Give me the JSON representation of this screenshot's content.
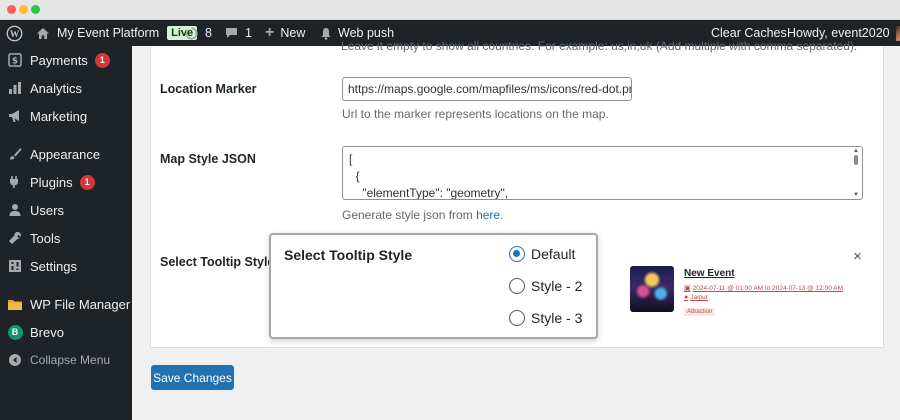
{
  "admin_bar": {
    "site_name": "My Event Platform",
    "live_badge": "Live",
    "updates_count": "8",
    "comments_count": "1",
    "new_label": "New",
    "web_push_label": "Web push",
    "clear_caches_label": "Clear Caches",
    "howdy_label": "Howdy, event2020"
  },
  "sidebar": {
    "items": [
      {
        "label": "Payments",
        "icon": "dollar-icon",
        "badge": "1"
      },
      {
        "label": "Analytics",
        "icon": "bar-chart-icon"
      },
      {
        "label": "Marketing",
        "icon": "megaphone-icon"
      },
      {
        "label": "Appearance",
        "icon": "paintbrush-icon"
      },
      {
        "label": "Plugins",
        "icon": "plugin-icon",
        "badge": "1"
      },
      {
        "label": "Users",
        "icon": "user-icon"
      },
      {
        "label": "Tools",
        "icon": "wrench-icon"
      },
      {
        "label": "Settings",
        "icon": "settings-icon"
      },
      {
        "label": "WP File Manager",
        "icon": "folder-icon"
      },
      {
        "label": "Brevo",
        "icon": "brevo-icon"
      },
      {
        "label": "Collapse Menu",
        "icon": "collapse-icon"
      }
    ]
  },
  "form": {
    "cut_off_description": "Leave it empty to show all countries. For example: us,in,uk (Add multiple with comma separated).",
    "location_marker": {
      "label": "Location Marker",
      "value": "https://maps.google.com/mapfiles/ms/icons/red-dot.png",
      "description": "Url to the marker represents locations on the map."
    },
    "map_style_json": {
      "label": "Map Style JSON",
      "lines": [
        "[",
        "  {",
        "    \"elementType\": \"geometry\","
      ],
      "description_prefix": "Generate style json from ",
      "description_link": "here."
    },
    "tooltip_style": {
      "label": "Select Tooltip Style"
    }
  },
  "tooltip_popup": {
    "title": "Select Tooltip Style",
    "options": [
      {
        "label": "Default",
        "checked": true
      },
      {
        "label": "Style - 2",
        "checked": false
      },
      {
        "label": "Style - 3",
        "checked": false
      }
    ]
  },
  "preview_card": {
    "close_symbol": "×",
    "title": "New Event",
    "date_range": "2024-07-11 @ 01:00 AM to 2024-07-13 @ 12:00 AM",
    "location": "Jaipur",
    "category": "Attraction"
  },
  "save_button_label": "Save Changes",
  "colors": {
    "admin_bg": "#1d2327",
    "primary": "#2271b1",
    "badge_red": "#d63638",
    "live_badge_bg": "#d7f3d6"
  }
}
